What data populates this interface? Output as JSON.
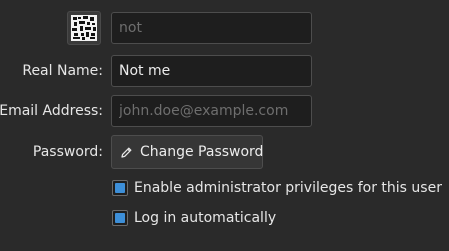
{
  "user_form": {
    "username": {
      "placeholder": "not"
    },
    "real_name": {
      "label": "Real Name:",
      "value": "Not me"
    },
    "email": {
      "label": "Email Address:",
      "placeholder": "john.doe@example.com"
    },
    "password": {
      "label": "Password:",
      "button_label": "Change Password",
      "button_icon": "pencil-icon"
    },
    "options": [
      {
        "label": "Enable administrator privileges for this user",
        "checked": true
      },
      {
        "label": "Log in automatically",
        "checked": true
      }
    ],
    "colors": {
      "accent": "#3d8fd8",
      "background": "#2a2a2a",
      "field_background": "#1e1e1e"
    }
  }
}
